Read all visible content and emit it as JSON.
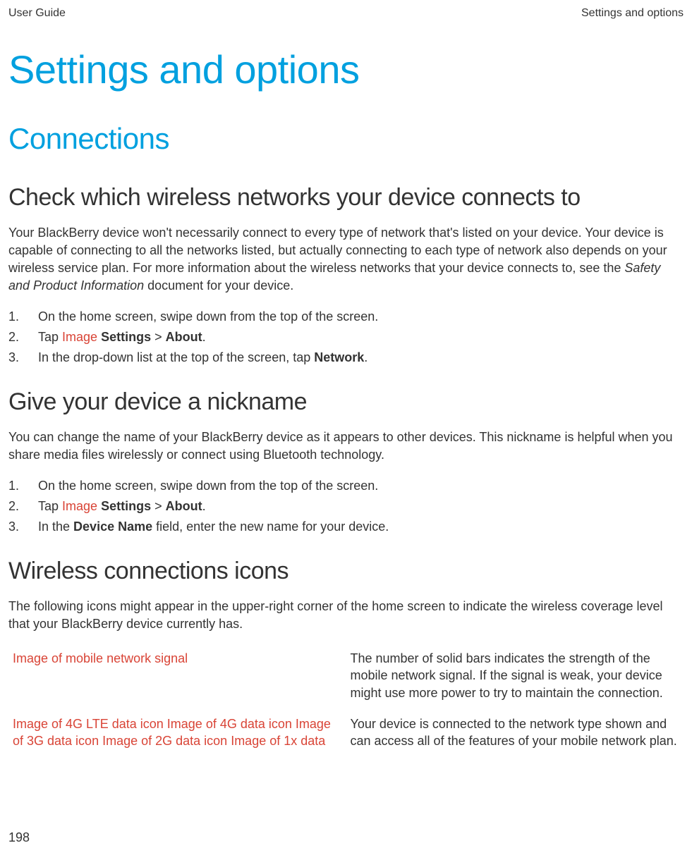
{
  "header": {
    "left": "User Guide",
    "right": "Settings and options"
  },
  "title": "Settings and options",
  "section1": {
    "heading": "Connections",
    "sub1": {
      "heading": "Check which wireless networks your device connects to",
      "para_a": "Your BlackBerry device won't necessarily connect to every type of network that's listed on your device. Your device is capable of connecting to all the networks listed, but actually connecting to each type of network also depends on your wireless service plan. For more information about the wireless networks that your device connects to, see the ",
      "para_italic": "Safety and Product Information",
      "para_b": " document for your device.",
      "steps": [
        {
          "n": "1.",
          "text": "On the home screen, swipe down from the top of the screen."
        },
        {
          "n": "2.",
          "pre": "Tap  ",
          "img": "Image",
          "post_a": " ",
          "bold1": "Settings",
          "mid": " > ",
          "bold2": "About",
          "end": "."
        },
        {
          "n": "3.",
          "pre": "In the drop-down list at the top of the screen, tap ",
          "bold1": "Network",
          "end": "."
        }
      ]
    },
    "sub2": {
      "heading": "Give your device a nickname",
      "para": "You can change the name of your BlackBerry device as it appears to other devices. This nickname is helpful when you share media files wirelessly or connect using Bluetooth technology.",
      "steps": [
        {
          "n": "1.",
          "text": "On the home screen, swipe down from the top of the screen."
        },
        {
          "n": "2.",
          "pre": "Tap  ",
          "img": "Image",
          "post_a": "  ",
          "bold1": "Settings",
          "mid": " > ",
          "bold2": "About",
          "end": "."
        },
        {
          "n": "3.",
          "pre": "In the ",
          "bold1": "Device Name",
          "post": " field, enter the new name for your device."
        }
      ]
    },
    "sub3": {
      "heading": "Wireless connections icons",
      "para": "The following icons might appear in the upper-right corner of the home screen to indicate the wireless coverage level that your BlackBerry device currently has.",
      "rows": [
        {
          "left": "Image of mobile network signal",
          "right": "The number of solid bars indicates the strength of the mobile network signal. If the signal is weak, your device might use more power to try to maintain the connection."
        },
        {
          "left": "Image of 4G LTE data icon  Image of 4G data icon  Image of 3G data icon  Image of 2G data icon  Image of 1x data",
          "right": "Your device is connected to the network type shown and can access all of the features of your mobile network plan."
        }
      ]
    }
  },
  "pageNumber": "198"
}
